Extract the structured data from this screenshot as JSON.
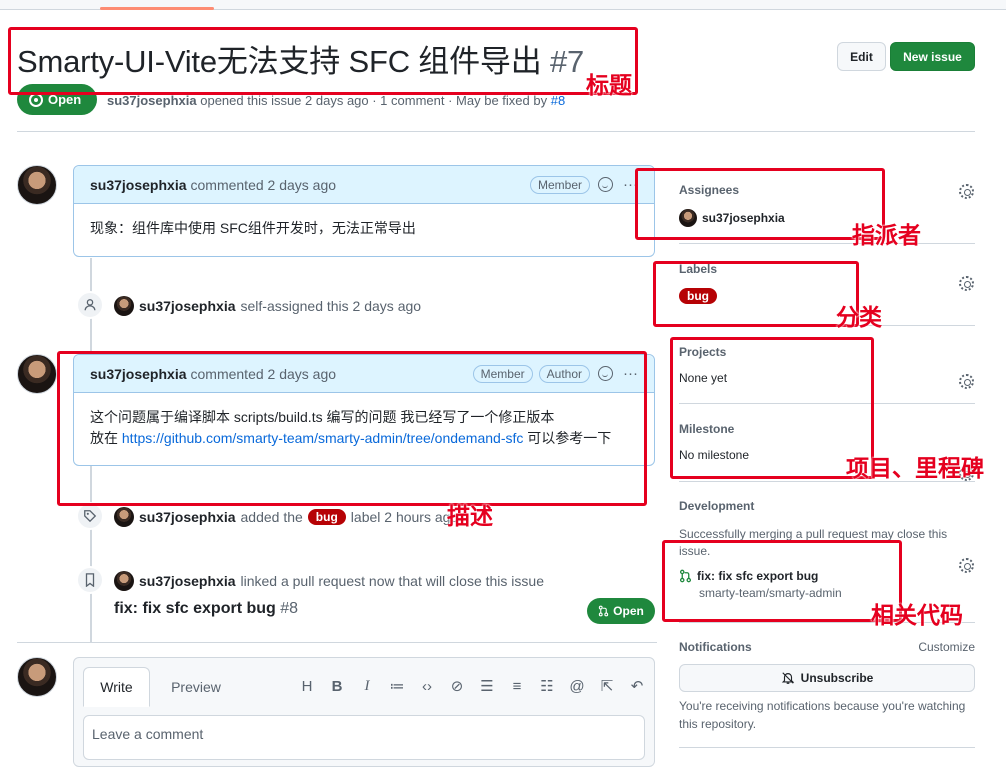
{
  "issue": {
    "title": "Smarty-UI-Vite无法支持 SFC 组件导出",
    "number": "#7",
    "state": "Open",
    "author": "su37josephxia",
    "meta_text": "opened this issue 2 days ago · 1 comment · May be fixed by",
    "fixed_by": "#8"
  },
  "header_buttons": {
    "edit": "Edit",
    "new_issue": "New issue"
  },
  "comments": [
    {
      "author": "su37josephxia",
      "action": "commented 2 days ago",
      "badges": [
        "Member"
      ],
      "body_line1": "现象：组件库中使用 SFC组件开发时，无法正常导出"
    },
    {
      "author": "su37josephxia",
      "action": "commented 2 days ago",
      "badges": [
        "Member",
        "Author"
      ],
      "body_line1": "这个问题属于编译脚本 scripts/build.ts 编写的问题 我已经写了一个修正版本",
      "body_line2_prefix": "放在",
      "link": "https://github.com/smarty-team/smarty-admin/tree/ondemand-sfc",
      "body_line2_suffix": "可以参考一下"
    }
  ],
  "events": {
    "self_assigned": {
      "actor": "su37josephxia",
      "text": "self-assigned this 2 days ago"
    },
    "labeled": {
      "actor": "su37josephxia",
      "text_before": "added the",
      "label": "bug",
      "text_after": "label 2 hours ago"
    },
    "linked": {
      "actor": "su37josephxia",
      "text": "linked a pull request now that will close this issue",
      "pr_title": "fix: fix sfc export bug",
      "pr_number": "#8",
      "pr_state": "Open"
    }
  },
  "editor": {
    "tab_write": "Write",
    "tab_preview": "Preview",
    "placeholder": "Leave a comment",
    "toolbar_icons": [
      "heading-icon",
      "bold-icon",
      "italic-icon",
      "quote-icon",
      "code-icon",
      "link-icon",
      "unordered-list-icon",
      "ordered-list-icon",
      "task-list-icon",
      "mention-icon",
      "reference-icon",
      "undo-icon"
    ]
  },
  "sidebar": {
    "assignees": {
      "title": "Assignees",
      "value": "su37josephxia"
    },
    "labels": {
      "title": "Labels",
      "value": "bug"
    },
    "projects": {
      "title": "Projects",
      "value": "None yet"
    },
    "milestone": {
      "title": "Milestone",
      "value": "No milestone"
    },
    "development": {
      "title": "Development",
      "desc": "Successfully merging a pull request may close this issue.",
      "pr_title": "fix: fix sfc export bug",
      "pr_repo": "smarty-team/smarty-admin"
    },
    "notifications": {
      "title": "Notifications",
      "customize": "Customize",
      "button": "Unsubscribe",
      "desc": "You're receiving notifications because you're watching this repository."
    }
  },
  "annotations": {
    "title": "标题",
    "assignee": "指派者",
    "category": "分类",
    "project_milestone": "项目、里程碑",
    "description": "描述",
    "related_code": "相关代码"
  },
  "colors": {
    "accent_red": "#e5001f",
    "open_green": "#1f883d",
    "bug_label": "#b60205",
    "link": "#0969da"
  }
}
